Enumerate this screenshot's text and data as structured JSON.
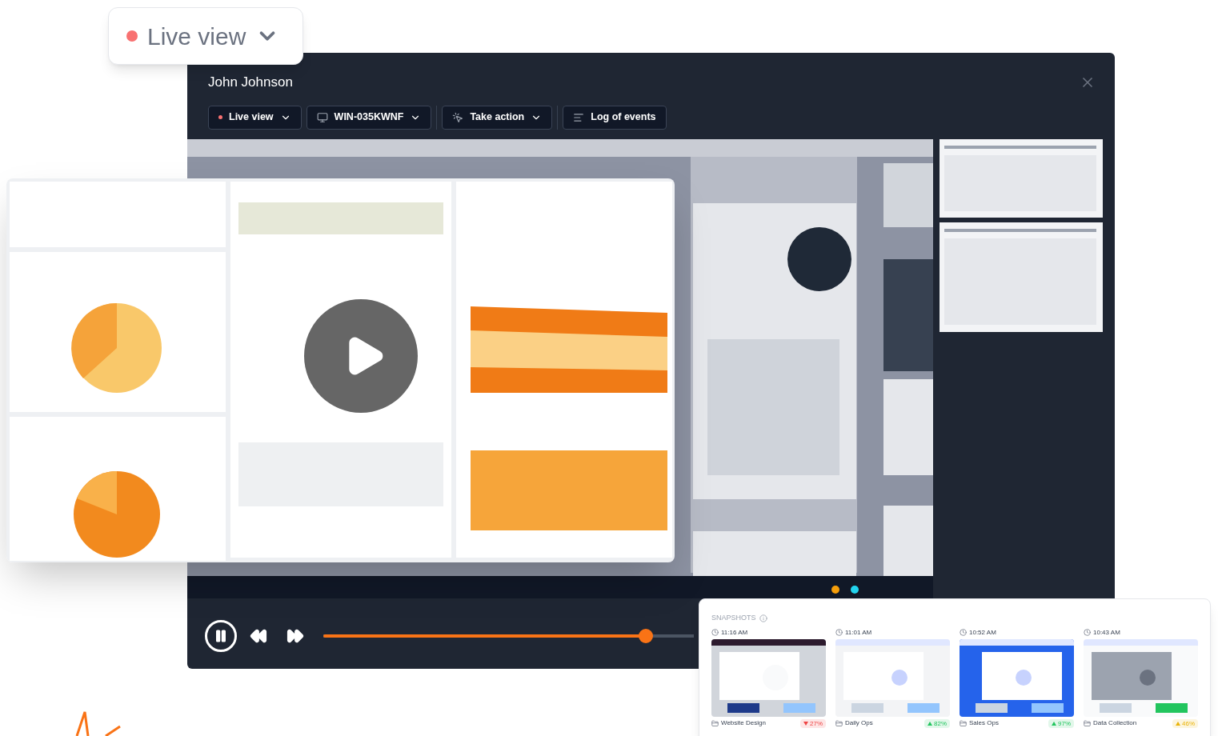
{
  "floating_badge": {
    "label": "Live view",
    "live": true
  },
  "window": {
    "title": "John Johnson"
  },
  "toolbar": [
    {
      "kind": "live",
      "label": "Live view"
    },
    {
      "kind": "device",
      "label": "WIN-035KWNF"
    },
    {
      "kind": "action",
      "label": "Take action"
    },
    {
      "kind": "log",
      "label": "Log of events"
    }
  ],
  "player": {
    "playing": true,
    "level": 0.87
  },
  "snapshots": {
    "title": "SNAPSHOTS",
    "items": [
      {
        "time": "11:16 AM",
        "label": "Website Design",
        "score": "27%",
        "rising": false,
        "color": "#ef4444"
      },
      {
        "time": "11:01 AM",
        "label": "Daily Ops",
        "score": "82%",
        "rising": true,
        "color": "#22c55e"
      },
      {
        "time": "10:52 AM",
        "label": "Sales Ops",
        "score": "97%",
        "rising": true,
        "color": "#22c55e"
      },
      {
        "time": "10:43 AM",
        "label": "Data Collection",
        "score": "46%",
        "rising": true,
        "color": "#eab308"
      }
    ]
  }
}
